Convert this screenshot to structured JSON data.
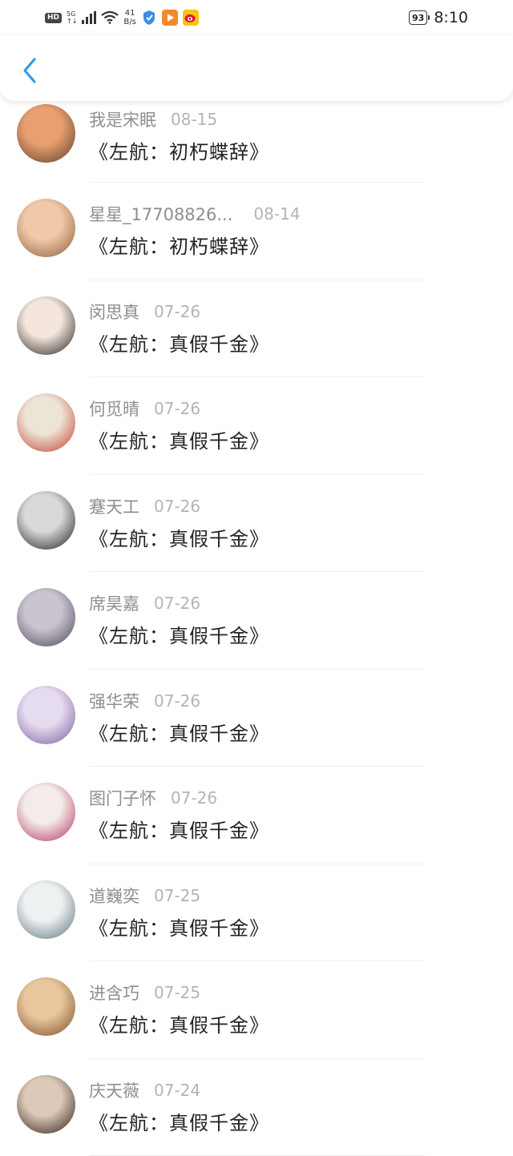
{
  "status_bar": {
    "hd": "HD",
    "network_top": "5G",
    "network_bottom": "↑↓",
    "speed_value": "41",
    "speed_unit": "B/s",
    "battery": "93",
    "time": "8:10"
  },
  "header": {
    "back_icon": "chevron-left-icon",
    "accent": "#2f9ce8"
  },
  "items": [
    {
      "name": "我是宋眠",
      "date": "08-15",
      "book": "《左航：初朽蝶辞》",
      "avatar_colors": [
        "#e8a070",
        "#5a3b2a"
      ]
    },
    {
      "name": "星星_17708826...",
      "date": "08-14",
      "book": "《左航：初朽蝶辞》",
      "avatar_colors": [
        "#f0c9a8",
        "#8a5a3a"
      ]
    },
    {
      "name": "闵思真",
      "date": "07-26",
      "book": "《左航：真假千金》",
      "avatar_colors": [
        "#f4e6dc",
        "#1e1e1e"
      ]
    },
    {
      "name": "何觅晴",
      "date": "07-26",
      "book": "《左航：真假千金》",
      "avatar_colors": [
        "#ece4d6",
        "#c0392b"
      ]
    },
    {
      "name": "蹇天工",
      "date": "07-26",
      "book": "《左航：真假千金》",
      "avatar_colors": [
        "#d9d9d9",
        "#1a1a1a"
      ]
    },
    {
      "name": "席昊嘉",
      "date": "07-26",
      "book": "《左航：真假千金》",
      "avatar_colors": [
        "#c9c4cf",
        "#4a4456"
      ]
    },
    {
      "name": "强华荣",
      "date": "07-26",
      "book": "《左航：真假千金》",
      "avatar_colors": [
        "#e6dcef",
        "#7a5aa0"
      ]
    },
    {
      "name": "图门子怀",
      "date": "07-26",
      "book": "《左航：真假千金》",
      "avatar_colors": [
        "#f3ece8",
        "#b0305a"
      ]
    },
    {
      "name": "道巍奕",
      "date": "07-25",
      "book": "《左航：真假千金》",
      "avatar_colors": [
        "#eef1f2",
        "#58707a"
      ]
    },
    {
      "name": "进含巧",
      "date": "07-25",
      "book": "《左航：真假千金》",
      "avatar_colors": [
        "#e9c79e",
        "#7a4a22"
      ]
    },
    {
      "name": "庆天薇",
      "date": "07-24",
      "book": "《左航：真假千金》",
      "avatar_colors": [
        "#dcc9b8",
        "#2a1a14"
      ]
    }
  ]
}
